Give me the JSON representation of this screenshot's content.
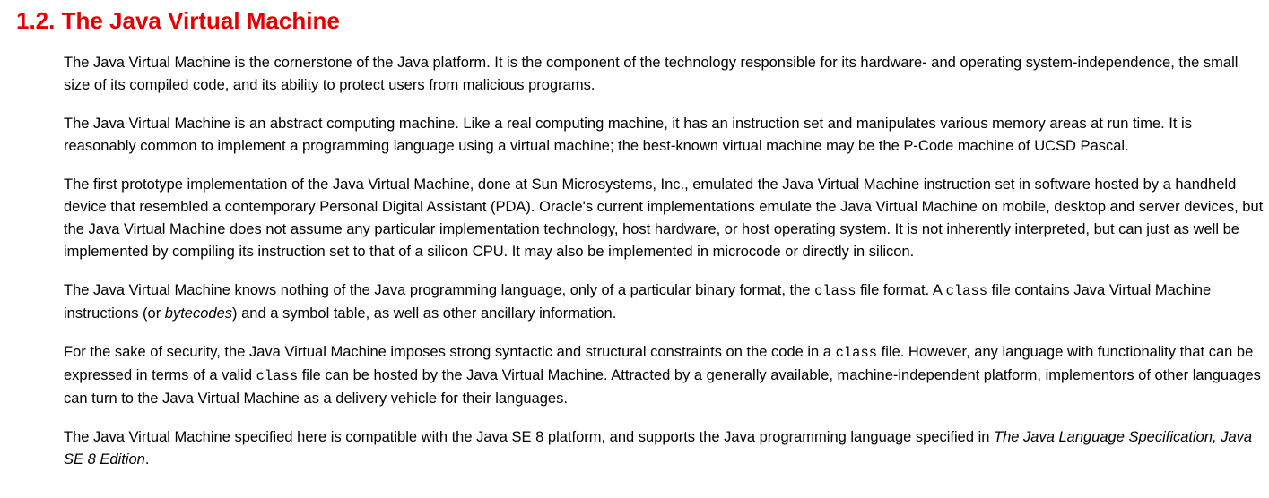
{
  "section": {
    "heading": "1.2. The Java Virtual Machine"
  },
  "paragraphs": {
    "p1": "The Java Virtual Machine is the cornerstone of the Java platform. It is the component of the technology responsible for its hardware- and operating system-independence, the small size of its compiled code, and its ability to protect users from malicious programs.",
    "p2": "The Java Virtual Machine is an abstract computing machine. Like a real computing machine, it has an instruction set and manipulates various memory areas at run time. It is reasonably common to implement a programming language using a virtual machine; the best-known virtual machine may be the P-Code machine of UCSD Pascal.",
    "p3": "The first prototype implementation of the Java Virtual Machine, done at Sun Microsystems, Inc., emulated the Java Virtual Machine instruction set in software hosted by a handheld device that resembled a contemporary Personal Digital Assistant (PDA). Oracle's current implementations emulate the Java Virtual Machine on mobile, desktop and server devices, but the Java Virtual Machine does not assume any particular implementation technology, host hardware, or host operating system. It is not inherently interpreted, but can just as well be implemented by compiling its instruction set to that of a silicon CPU. It may also be implemented in microcode or directly in silicon.",
    "p4": {
      "t1": "The Java Virtual Machine knows nothing of the Java programming language, only of a particular binary format, the ",
      "c1": "class",
      "t2": " file format. A ",
      "c2": "class",
      "t3": " file contains Java Virtual Machine instructions (or ",
      "e1": "bytecodes",
      "t4": ") and a symbol table, as well as other ancillary information."
    },
    "p5": {
      "t1": "For the sake of security, the Java Virtual Machine imposes strong syntactic and structural constraints on the code in a ",
      "c1": "class",
      "t2": " file. However, any language with functionality that can be expressed in terms of a valid ",
      "c2": "class",
      "t3": " file can be hosted by the Java Virtual Machine. Attracted by a generally available, machine-independent platform, implementors of other languages can turn to the Java Virtual Machine as a delivery vehicle for their languages."
    },
    "p6": {
      "t1": "The Java Virtual Machine specified here is compatible with the Java SE 8 platform, and supports the Java programming language specified in ",
      "e1": "The Java Language Specification, Java SE 8 Edition",
      "t2": "."
    }
  }
}
